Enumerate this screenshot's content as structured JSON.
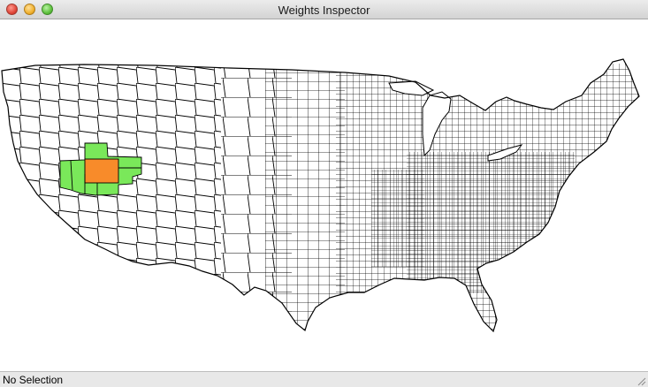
{
  "window": {
    "title": "Weights Inspector"
  },
  "status": {
    "text": "No Selection"
  },
  "map": {
    "region": "contiguous-united-states-counties",
    "colors": {
      "outline": "#000000",
      "fill": "#ffffff",
      "selected": "#f88b2a",
      "neighbor": "#7ae85a"
    }
  }
}
